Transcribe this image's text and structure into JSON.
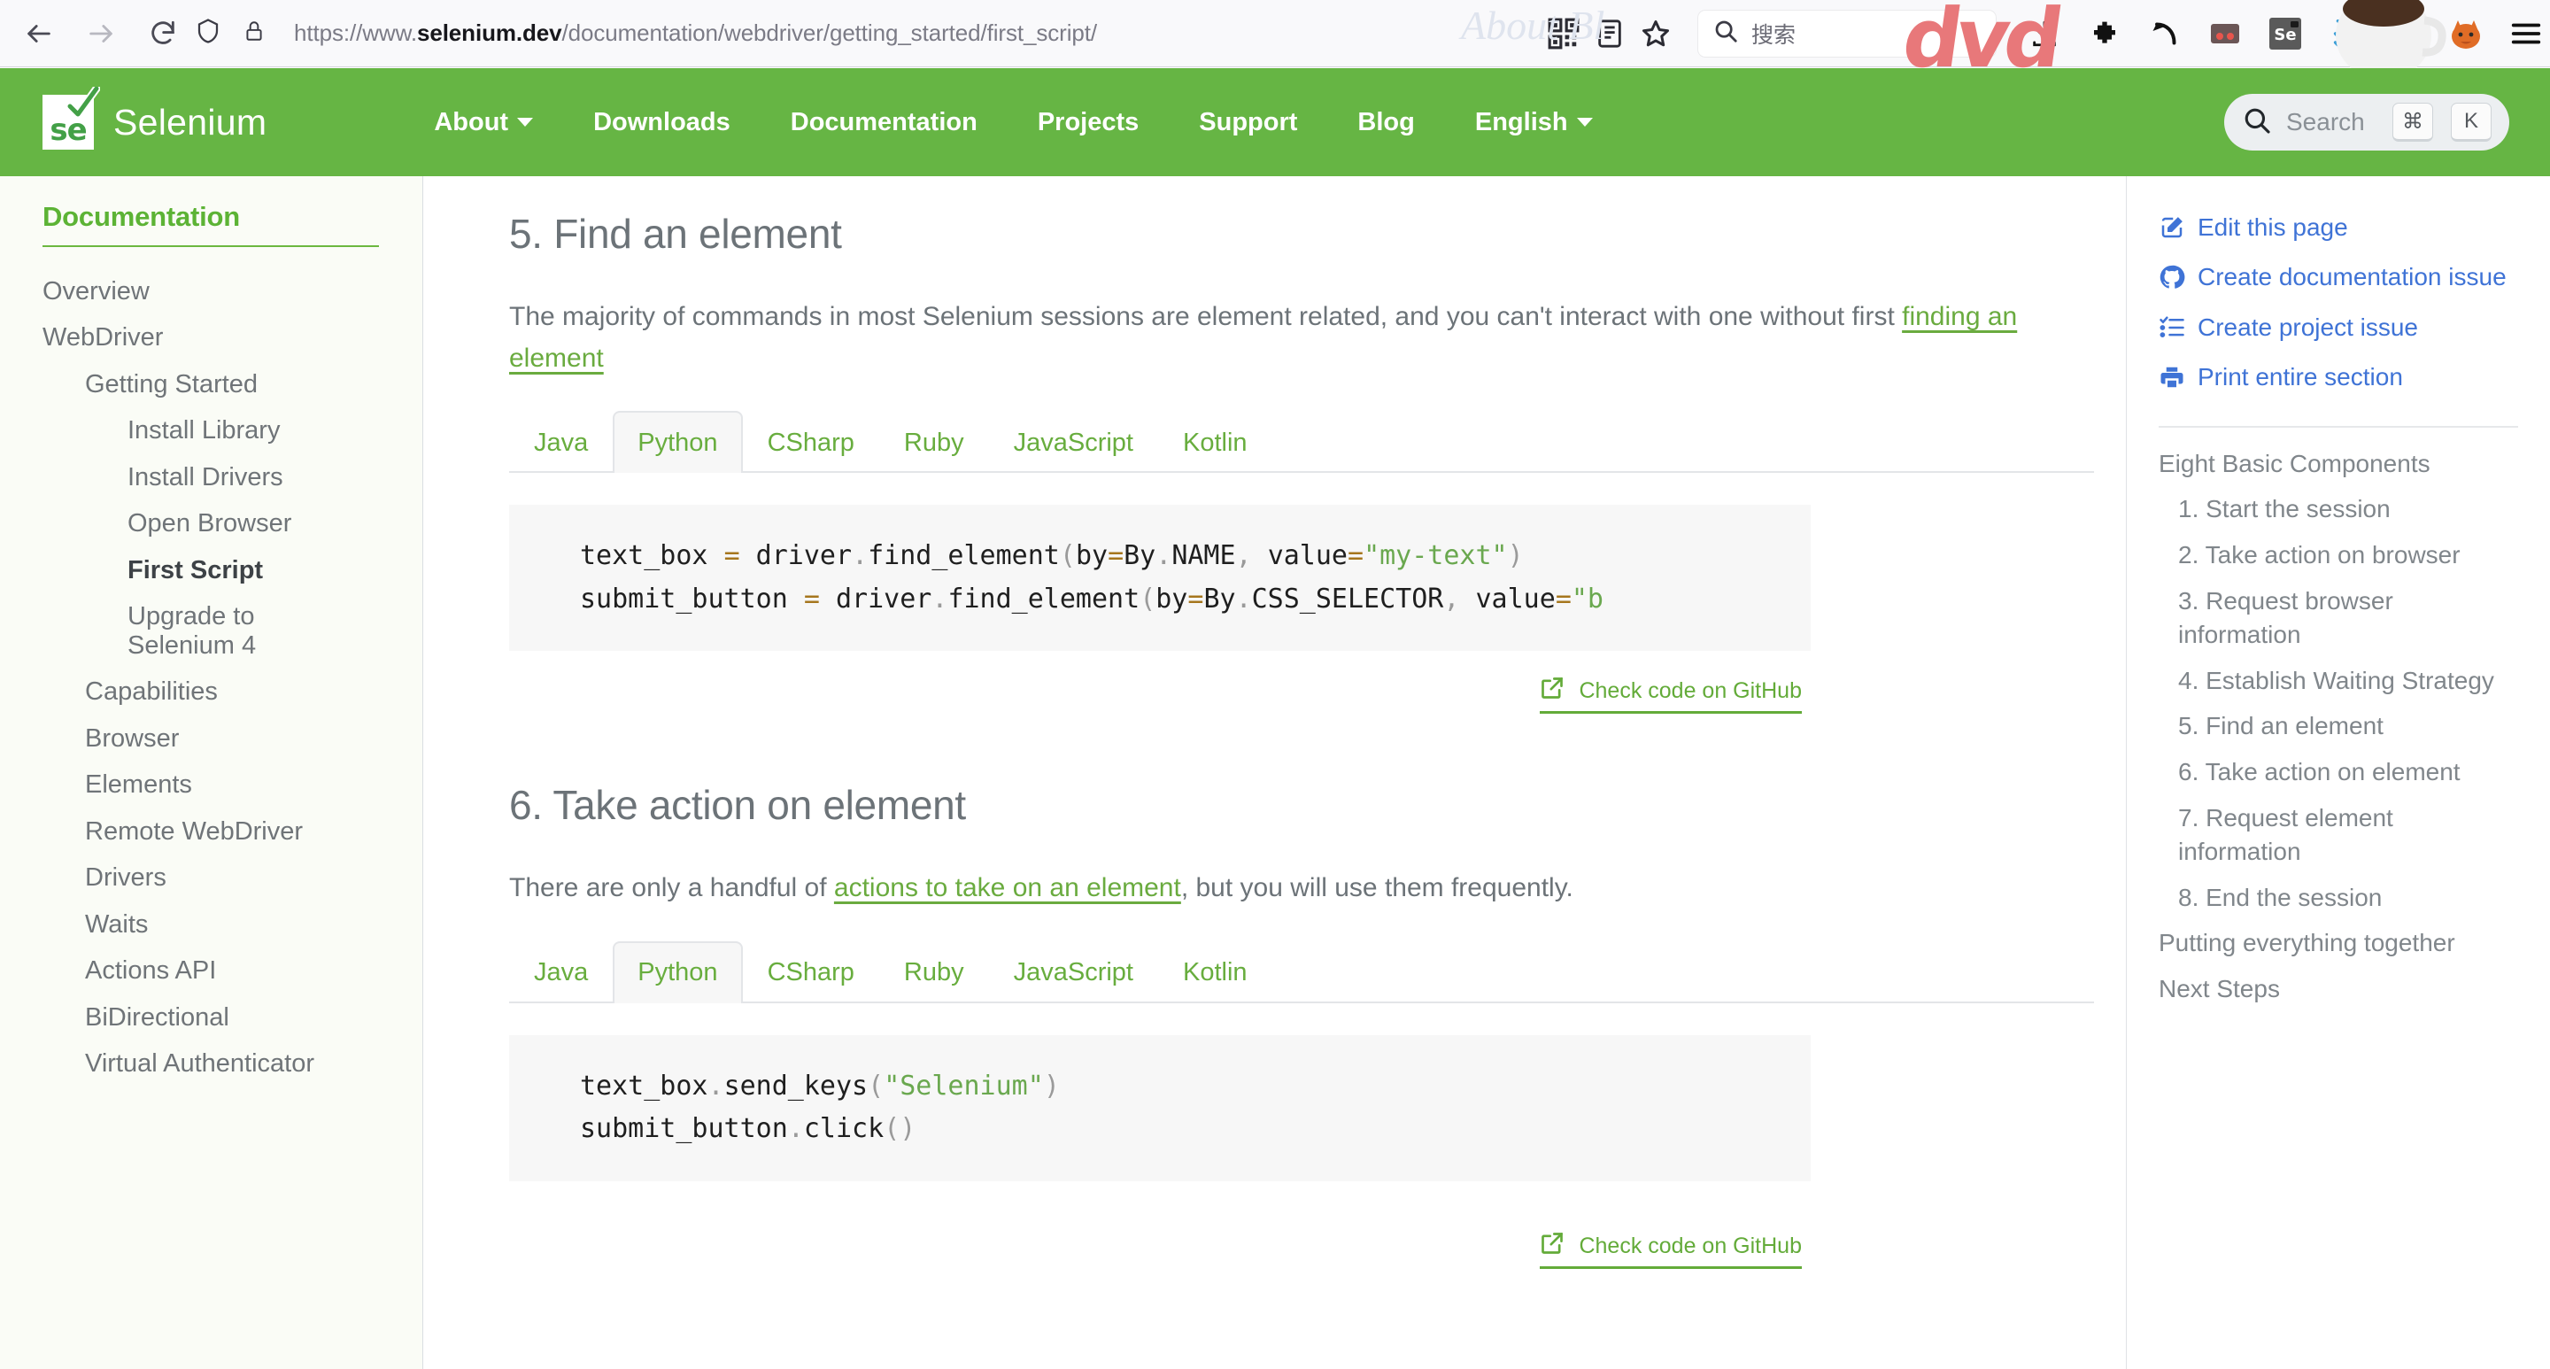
{
  "browser": {
    "url_prefix": "https://www.",
    "url_host": "selenium.dev",
    "url_suffix": "/documentation/webdriver/getting_started/first_script/",
    "search_placeholder": "搜索",
    "watermark_dvd": "dvd",
    "watermark_about": "About Bl",
    "icons": {
      "back": "back-arrow-icon",
      "forward": "forward-arrow-icon",
      "reload": "reload-icon",
      "shield": "shield-icon",
      "lock": "lock-icon",
      "qr": "qr-code-icon",
      "reader": "reader-view-icon",
      "bookmark": "bookmark-star-icon",
      "search": "search-icon",
      "download": "download-icon",
      "extension": "extension-icon",
      "undo": "undo-arrow-icon",
      "glasses": "glasses-icon",
      "selenium_ide": "selenium-ide-icon",
      "chevrons": "double-chevron-down-icon",
      "notion": "notion-clipper-icon",
      "firefox_account": "firefox-account-icon",
      "menu": "hamburger-menu-icon"
    }
  },
  "header": {
    "brand": "Selenium",
    "logo_text": "se",
    "nav": [
      {
        "label": "About",
        "has_caret": true
      },
      {
        "label": "Downloads",
        "has_caret": false
      },
      {
        "label": "Documentation",
        "has_caret": false
      },
      {
        "label": "Projects",
        "has_caret": false
      },
      {
        "label": "Support",
        "has_caret": false
      },
      {
        "label": "Blog",
        "has_caret": false
      },
      {
        "label": "English",
        "has_caret": true
      }
    ],
    "search": {
      "placeholder": "Search",
      "key_modifier": "⌘",
      "key_letter": "K"
    },
    "accent_color": "#66b544"
  },
  "sidebar": {
    "title": "Documentation",
    "items": [
      {
        "label": "Overview",
        "level": 1,
        "active": false
      },
      {
        "label": "WebDriver",
        "level": 1,
        "active": false
      },
      {
        "label": "Getting Started",
        "level": 2,
        "active": false
      },
      {
        "label": "Install Library",
        "level": 3,
        "active": false
      },
      {
        "label": "Install Drivers",
        "level": 3,
        "active": false
      },
      {
        "label": "Open Browser",
        "level": 3,
        "active": false
      },
      {
        "label": "First Script",
        "level": 3,
        "active": true
      },
      {
        "label": "Upgrade to Selenium 4",
        "level": 3,
        "active": false,
        "wrap": true
      },
      {
        "label": "Capabilities",
        "level": 2,
        "active": false
      },
      {
        "label": "Browser",
        "level": 2,
        "active": false
      },
      {
        "label": "Elements",
        "level": 2,
        "active": false
      },
      {
        "label": "Remote WebDriver",
        "level": 2,
        "active": false
      },
      {
        "label": "Drivers",
        "level": 2,
        "active": false
      },
      {
        "label": "Waits",
        "level": 2,
        "active": false
      },
      {
        "label": "Actions API",
        "level": 2,
        "active": false
      },
      {
        "label": "BiDirectional",
        "level": 2,
        "active": false
      },
      {
        "label": "Virtual Authenticator",
        "level": 2,
        "active": false
      }
    ]
  },
  "main": {
    "section5": {
      "heading": "5. Find an element",
      "paragraph_before": "The majority of commands in most Selenium sessions are element related, and you can't interact with one without first ",
      "paragraph_link": "finding an element",
      "tabs": [
        "Java",
        "Python",
        "CSharp",
        "Ruby",
        "JavaScript",
        "Kotlin"
      ],
      "active_tab": "Python",
      "code": {
        "line1": {
          "a": "text_box ",
          "op1": "=",
          "b": " driver",
          "dot1": ".",
          "c": "find_element",
          "paren1": "(",
          "d": "by",
          "op2": "=",
          "e": "By",
          "dot2": ".",
          "f": "NAME",
          "comma": ", ",
          "g": "value",
          "op3": "=",
          "str": "\"my-text\"",
          "paren2": ")"
        },
        "line2": {
          "a": "submit_button ",
          "op1": "=",
          "b": " driver",
          "dot1": ".",
          "c": "find_element",
          "paren1": "(",
          "d": "by",
          "op2": "=",
          "e": "By",
          "dot2": ".",
          "f": "CSS_SELECTOR",
          "comma": ", ",
          "g": "value",
          "op3": "=",
          "str": "\"b"
        }
      },
      "github_link": "Check code on GitHub"
    },
    "section6": {
      "heading": "6. Take action on element",
      "paragraph_before": "There are only a handful of ",
      "paragraph_link": "actions to take on an element",
      "paragraph_after": ", but you will use them frequently.",
      "tabs": [
        "Java",
        "Python",
        "CSharp",
        "Ruby",
        "JavaScript",
        "Kotlin"
      ],
      "active_tab": "Python",
      "code": {
        "line1": {
          "a": "text_box",
          "dot1": ".",
          "b": "send_keys",
          "paren1": "(",
          "str": "\"Selenium\"",
          "paren2": ")"
        },
        "line2": {
          "a": "submit_button",
          "dot1": ".",
          "b": "click",
          "paren1": "()"
        }
      },
      "github_link": "Check code on GitHub"
    }
  },
  "right_sidebar": {
    "actions": [
      {
        "label": "Edit this page",
        "icon": "edit-pencil-icon"
      },
      {
        "label": "Create documentation issue",
        "icon": "github-icon"
      },
      {
        "label": "Create project issue",
        "icon": "task-list-icon"
      },
      {
        "label": "Print entire section",
        "icon": "printer-icon"
      }
    ],
    "toc_title": "Eight Basic Components",
    "toc": [
      {
        "label": "1. Start the session",
        "sub": true
      },
      {
        "label": "2. Take action on browser",
        "sub": true
      },
      {
        "label": "3. Request browser information",
        "sub": true
      },
      {
        "label": "4. Establish Waiting Strategy",
        "sub": true
      },
      {
        "label": "5. Find an element",
        "sub": true
      },
      {
        "label": "6. Take action on element",
        "sub": true
      },
      {
        "label": "7. Request element information",
        "sub": true
      },
      {
        "label": "8. End the session",
        "sub": true
      },
      {
        "label": "Putting everything together",
        "sub": false
      },
      {
        "label": "Next Steps",
        "sub": false
      }
    ],
    "link_color": "#3f73d6"
  }
}
